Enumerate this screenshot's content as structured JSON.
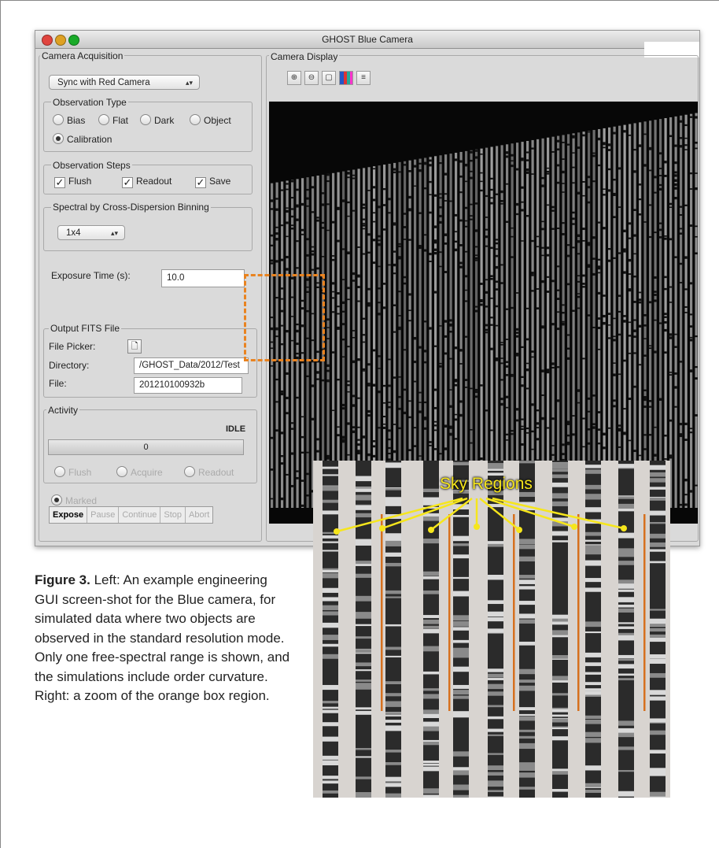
{
  "window": {
    "title": "GHOST Blue Camera"
  },
  "acquisition": {
    "legend": "Camera Acquisition",
    "sync_select": "Sync with Red Camera",
    "observation_type": {
      "legend": "Observation Type",
      "options": [
        "Bias",
        "Flat",
        "Dark",
        "Object",
        "Calibration"
      ],
      "selected": "Calibration"
    },
    "observation_steps": {
      "legend": "Observation Steps",
      "flush": "Flush",
      "readout": "Readout",
      "save": "Save",
      "flush_checked": true,
      "readout_checked": true,
      "save_checked": true
    },
    "binning": {
      "legend": "Spectral by Cross-Dispersion Binning",
      "value": "1x4"
    },
    "exposure": {
      "label": "Exposure Time (s):",
      "value": "10.0"
    },
    "output": {
      "legend": "Output FITS File",
      "picker_label": "File Picker:",
      "directory_label": "Directory:",
      "directory_value": "/GHOST_Data/2012/Test",
      "file_label": "File:",
      "file_value": "20121010093​2b"
    },
    "activity": {
      "legend": "Activity",
      "status": "IDLE",
      "progress_value": "0",
      "progress_fraction": 0,
      "phases": [
        "Flush",
        "Acquire",
        "Readout"
      ]
    },
    "marked": "Marked",
    "buttons": [
      "Expose",
      "Pause",
      "Continue",
      "Stop",
      "Abort"
    ]
  },
  "display": {
    "legend": "Camera Display",
    "tools": [
      "zoom-in-icon",
      "zoom-out-icon",
      "reset-icon",
      "histogram-icon",
      "colorbar-icon"
    ],
    "highlight_color": "#e98320"
  },
  "zoom": {
    "annotation": "Sky Regions",
    "annotation_color": "#f6e61c",
    "marker_color": "#d6701e"
  },
  "caption": {
    "label": "Figure 3.",
    "text": "Left: An example engineering GUI screen-shot for the Blue camera, for simulated data where two objects are observed in the standard resolution mode. Only one free-spectral range is shown, and the simulations include order curvature. Right: a zoom of the orange box region."
  }
}
